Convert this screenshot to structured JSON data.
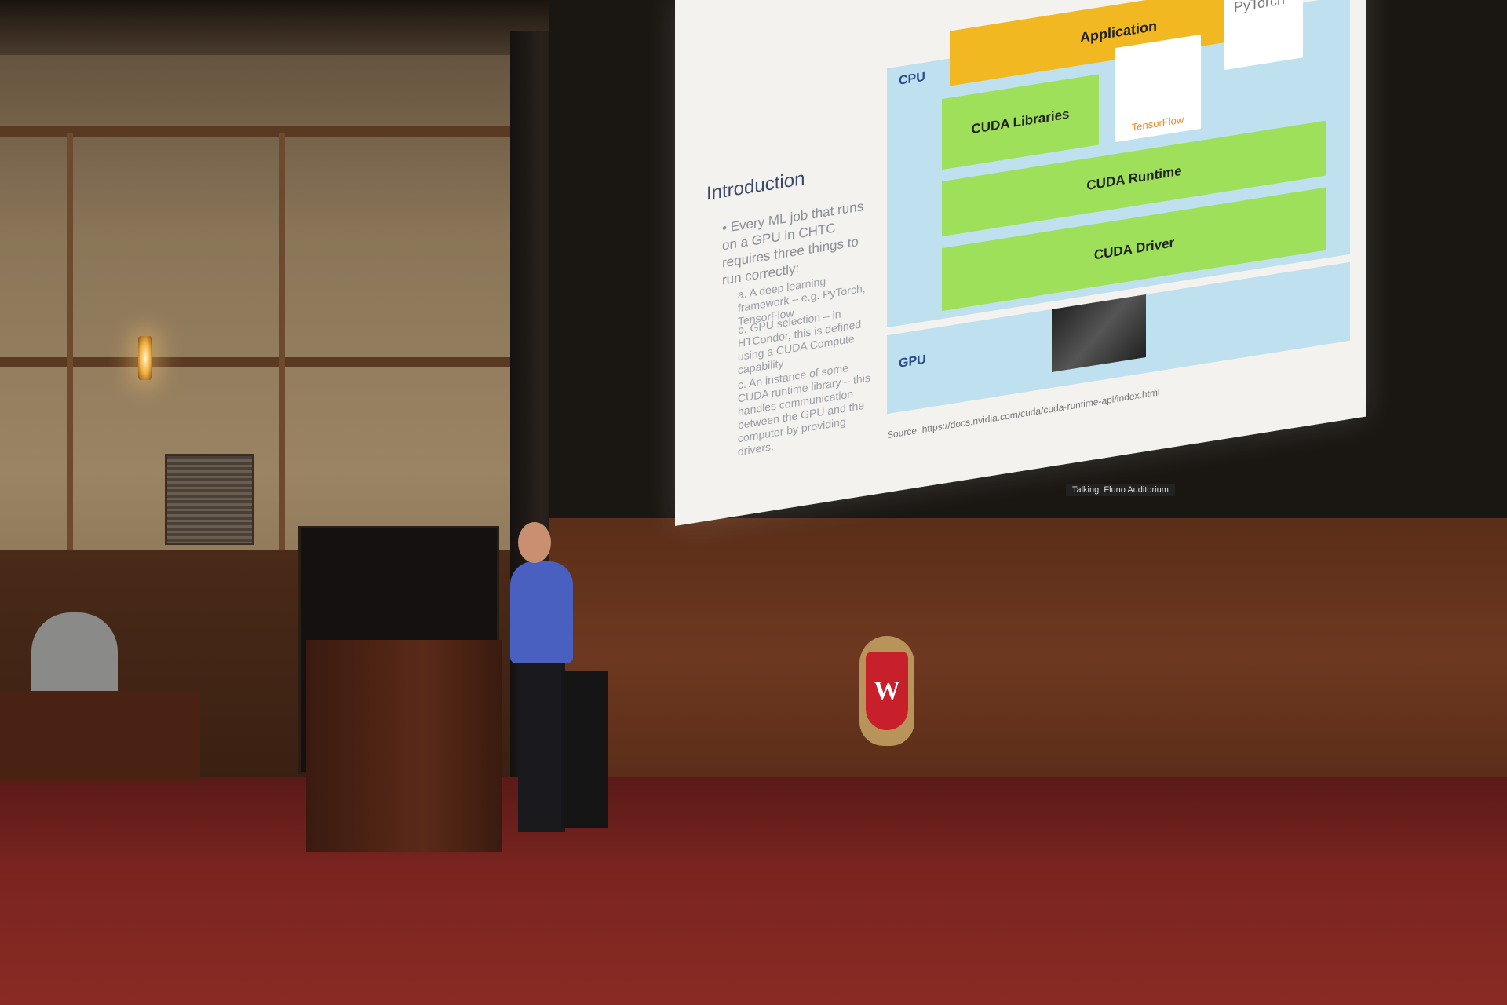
{
  "slide": {
    "title": "Introduction",
    "bullet": "Every ML job that runs on a GPU in CHTC requires three things to run correctly:",
    "items": [
      {
        "marker": "a.",
        "text": "A deep learning framework – e.g. PyTorch, TensorFlow"
      },
      {
        "marker": "b.",
        "text": "GPU selection – in HTCondor, this is defined using a CUDA Compute capability"
      },
      {
        "marker": "c.",
        "text": "An instance of some CUDA runtime library – this handles communication between the GPU and the computer by providing drivers."
      }
    ]
  },
  "diagram": {
    "cpu_label": "CPU",
    "gpu_label": "GPU",
    "application": "Application",
    "tensorflow": "TensorFlow",
    "pytorch": "PyTorch",
    "libraries": "CUDA Libraries",
    "runtime": "CUDA Runtime",
    "driver": "CUDA Driver",
    "source": "Source: https://docs.nvidia.com/cuda/cuda-runtime-api/index.html"
  },
  "overlay": {
    "talking": "Talking: Fluno Auditorium"
  },
  "crest": {
    "letter": "W"
  }
}
